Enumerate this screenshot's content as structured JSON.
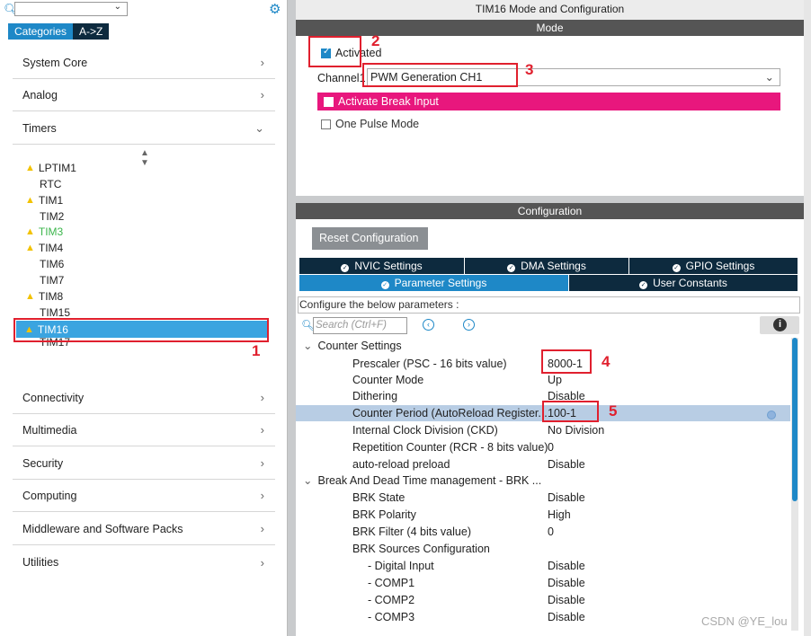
{
  "left_panel": {
    "tabs": [
      "Categories",
      "A->Z"
    ],
    "categories_top": [
      {
        "label": "System Core",
        "chevron": "›"
      },
      {
        "label": "Analog",
        "chevron": "›"
      },
      {
        "label": "Timers",
        "chevron": "⌄"
      }
    ],
    "timers": [
      {
        "label": "LPTIM1",
        "warn": true
      },
      {
        "label": "RTC",
        "warn": false
      },
      {
        "label": "TIM1",
        "warn": true
      },
      {
        "label": "TIM2",
        "warn": false
      },
      {
        "label": "TIM3",
        "warn": true,
        "color": "green"
      },
      {
        "label": "TIM4",
        "warn": true
      },
      {
        "label": "TIM6",
        "warn": false
      },
      {
        "label": "TIM7",
        "warn": false
      },
      {
        "label": "TIM8",
        "warn": true
      },
      {
        "label": "TIM15",
        "warn": false
      },
      {
        "label": "TIM16",
        "warn": true,
        "selected": true
      },
      {
        "label": "TIM17",
        "warn": false
      }
    ],
    "categories_bottom": [
      {
        "label": "Connectivity"
      },
      {
        "label": "Multimedia"
      },
      {
        "label": "Security"
      },
      {
        "label": "Computing"
      },
      {
        "label": "Middleware and Software Packs"
      },
      {
        "label": "Utilities"
      }
    ]
  },
  "annotations": [
    "1",
    "2",
    "3",
    "4",
    "5"
  ],
  "right_panel": {
    "title": "TIM16 Mode and Configuration",
    "mode_header": "Mode",
    "activated_label": "Activated",
    "channel_label": "Channel1",
    "channel_value": "PWM Generation CH1",
    "break_label": "Activate Break Input",
    "one_pulse_label": "One Pulse Mode",
    "config_header": "Configuration",
    "reset_label": "Reset Configuration",
    "settings_tabs_row1": [
      "NVIC Settings",
      "DMA Settings",
      "GPIO Settings"
    ],
    "settings_tabs_row2": [
      "Parameter Settings",
      "User Constants"
    ],
    "configure_label": "Configure the below parameters :",
    "search_placeholder": "Search (Ctrl+F)",
    "groups": [
      {
        "label": "Counter Settings"
      },
      {
        "label": "Break And Dead Time management - BRK ..."
      }
    ],
    "params": [
      {
        "name": "Prescaler (PSC - 16 bits value)",
        "value": "8000-1"
      },
      {
        "name": "Counter Mode",
        "value": "Up"
      },
      {
        "name": "Dithering",
        "value": "Disable"
      },
      {
        "name": "Counter Period (AutoReload Register...",
        "value": "100-1"
      },
      {
        "name": "Internal Clock Division (CKD)",
        "value": "No Division"
      },
      {
        "name": "Repetition Counter (RCR - 8 bits value)",
        "value": "0"
      },
      {
        "name": "auto-reload preload",
        "value": "Disable"
      },
      {
        "name": "BRK State",
        "value": "Disable"
      },
      {
        "name": "BRK Polarity",
        "value": "High"
      },
      {
        "name": "BRK Filter (4 bits value)",
        "value": "0"
      },
      {
        "name": "BRK Sources Configuration",
        "value": ""
      },
      {
        "name": "- Digital Input",
        "value": "Disable"
      },
      {
        "name": "- COMP1",
        "value": "Disable"
      },
      {
        "name": "- COMP2",
        "value": "Disable"
      },
      {
        "name": "- COMP3",
        "value": "Disable"
      }
    ]
  },
  "watermark": "CSDN @YE_lou",
  "colors": {
    "accent": "#1e88c7",
    "dark": "#0d2a3e",
    "pink": "#e8177d",
    "annotation": "#e0202e"
  }
}
